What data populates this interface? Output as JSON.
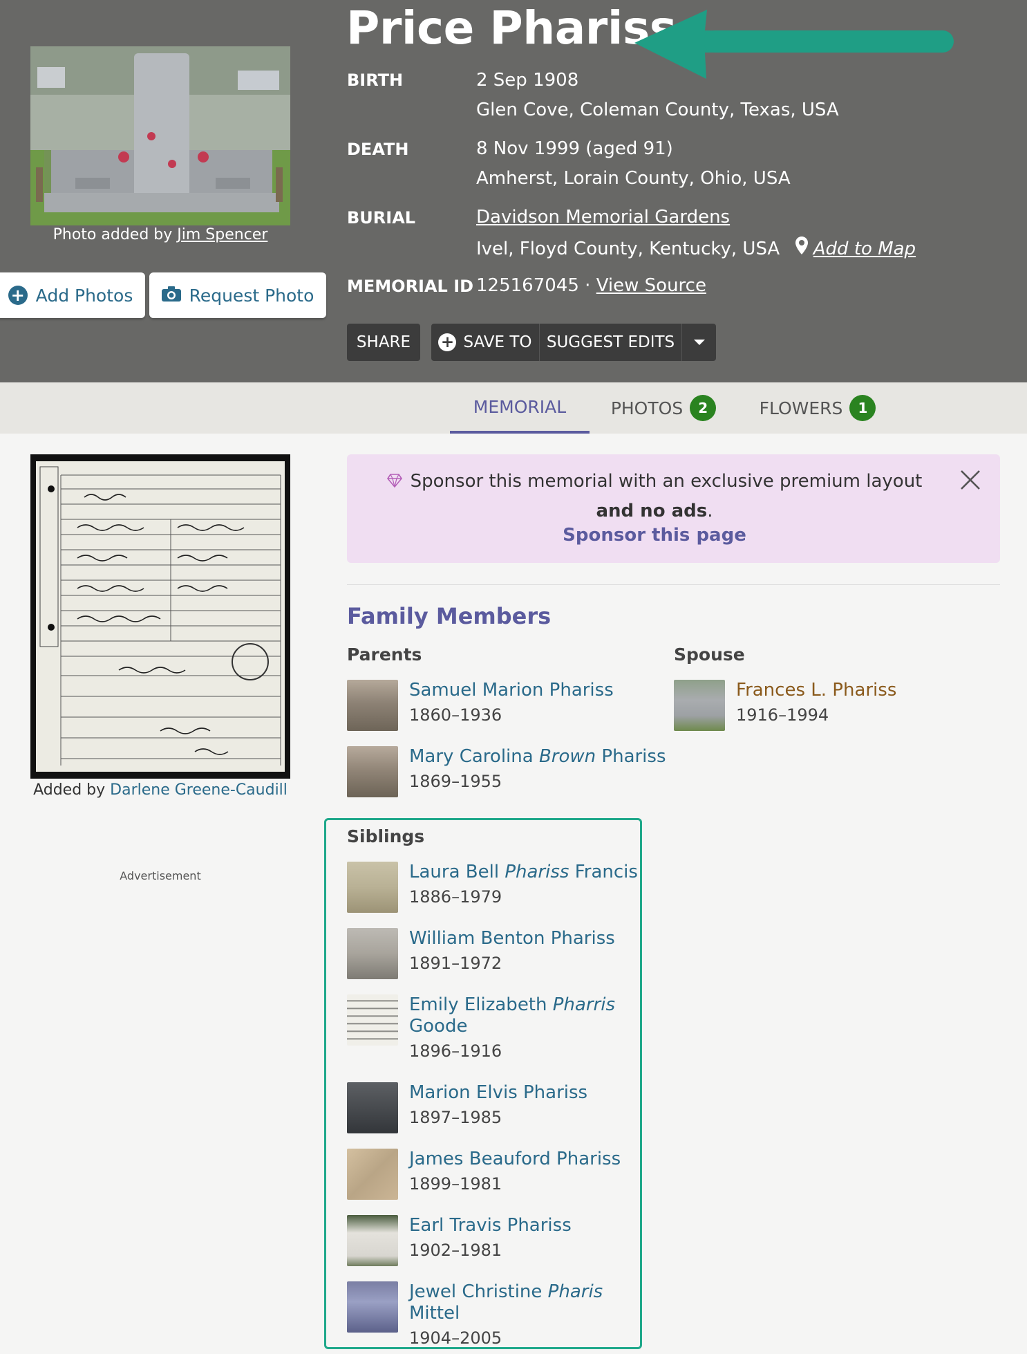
{
  "memorial": {
    "name": "Price Phariss",
    "photo_credit_prefix": "Photo added by",
    "photo_credit_name": "Jim Spencer"
  },
  "actions": {
    "add_photos": "Add Photos",
    "request_photo": "Request Photo",
    "share": "SHARE",
    "save_to": "SAVE TO",
    "suggest_edits": "SUGGEST EDITS"
  },
  "facts": {
    "birth_label": "BIRTH",
    "birth_date": "2 Sep 1908",
    "birth_place": "Glen Cove, Coleman County, Texas, USA",
    "death_label": "DEATH",
    "death_date": "8 Nov 1999 (aged 91)",
    "death_place": "Amherst, Lorain County, Ohio, USA",
    "burial_label": "BURIAL",
    "burial_cemetery": "Davidson Memorial Gardens",
    "burial_place": "Ivel, Floyd County, Kentucky, USA",
    "add_to_map": "Add to Map",
    "memorial_id_label": "MEMORIAL ID",
    "memorial_id": "125167045",
    "id_separator": "·",
    "view_source": "View Source"
  },
  "tabs": [
    {
      "label": "MEMORIAL"
    },
    {
      "label": "PHOTOS",
      "count": "2"
    },
    {
      "label": "FLOWERS",
      "count": "1"
    }
  ],
  "certificate": {
    "credit_prefix": "Added by",
    "credit_name": "Darlene Greene-Caudill"
  },
  "advertisement_label": "Advertisement",
  "sponsor": {
    "text": "Sponsor this memorial with an exclusive premium layout",
    "bold_text": "and no ads",
    "period": ".",
    "link": "Sponsor this page"
  },
  "family": {
    "title": "Family Members",
    "parents_title": "Parents",
    "spouse_title": "Spouse",
    "siblings_title": "Siblings",
    "parents": [
      {
        "first": "Samuel Marion Phariss",
        "maiden": "",
        "last": "",
        "dates": "1860–1936"
      },
      {
        "first": "Mary Carolina",
        "maiden": "Brown",
        "last": "Phariss",
        "dates": "1869–1955"
      }
    ],
    "spouse": [
      {
        "first": "Frances L. Phariss",
        "maiden": "",
        "last": "",
        "dates": "1916–1994"
      }
    ],
    "siblings": [
      {
        "first": "Laura Bell",
        "maiden": "Phariss",
        "last": "Francis",
        "dates": "1886–1979"
      },
      {
        "first": "William Benton Phariss",
        "maiden": "",
        "last": "",
        "dates": "1891–1972"
      },
      {
        "first": "Emily Elizabeth",
        "maiden": "Pharris",
        "last": "Goode",
        "dates": "1896–1916"
      },
      {
        "first": "Marion Elvis Phariss",
        "maiden": "",
        "last": "",
        "dates": "1897–1985"
      },
      {
        "first": "James Beauford Phariss",
        "maiden": "",
        "last": "",
        "dates": "1899–1981"
      },
      {
        "first": "Earl Travis Phariss",
        "maiden": "",
        "last": "",
        "dates": "1902–1981"
      },
      {
        "first": "Jewel Christine",
        "maiden": "Pharis",
        "last": "Mittel",
        "dates": "1904–2005"
      }
    ]
  },
  "colors": {
    "header_bg": "#686866",
    "link": "#2a6a8a",
    "accent_purple": "#5b5b9e",
    "badge_green": "#2a8320",
    "highlight_teal": "#1fa88a",
    "sponsor_bg": "#f0def2"
  },
  "icons": {
    "add": "plus-circle-icon",
    "camera": "camera-icon",
    "map_pin": "map-pin-icon",
    "gem": "gem-icon",
    "close": "close-icon",
    "dropdown": "caret-down-icon"
  }
}
